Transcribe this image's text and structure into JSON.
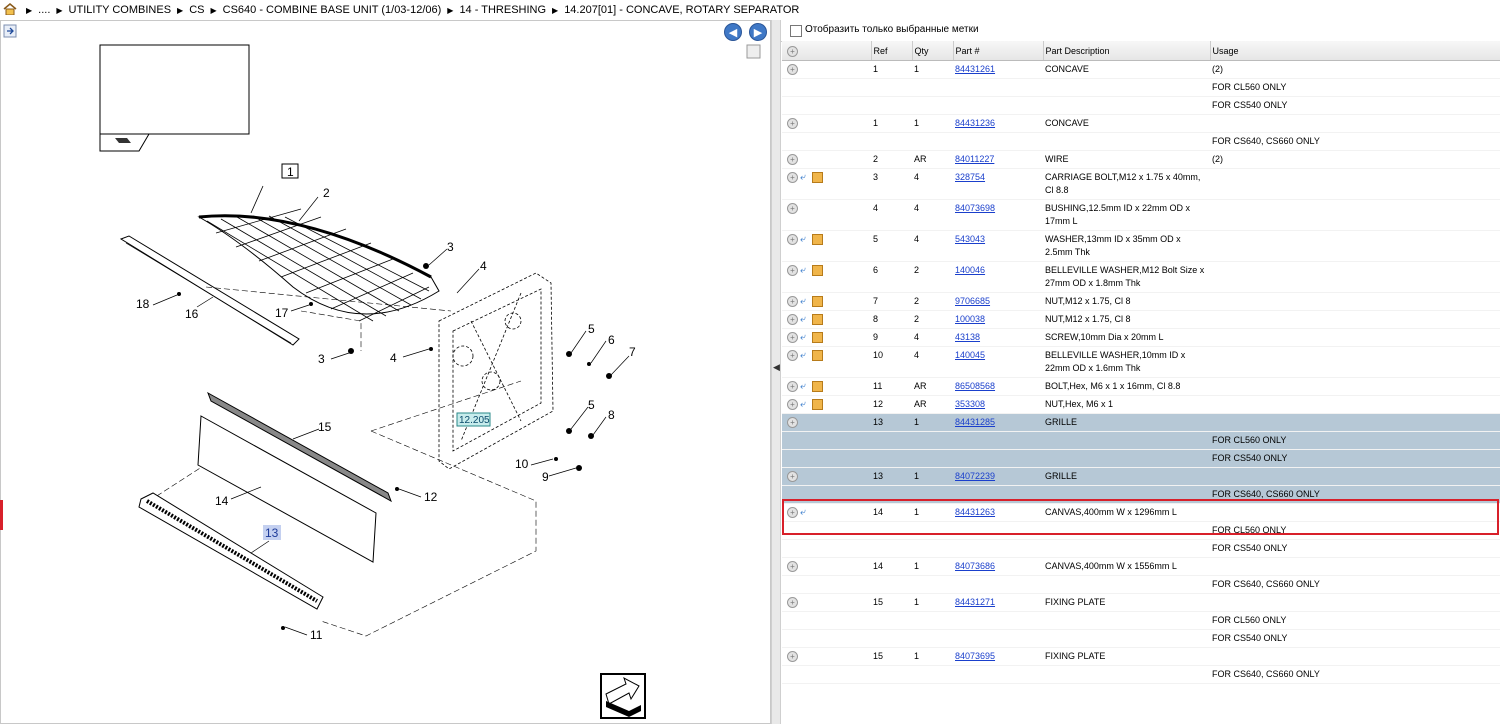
{
  "breadcrumb": {
    "items": [
      "....",
      "UTILITY COMBINES",
      "CS",
      "CS640 - COMBINE BASE UNIT (1/03-12/06)",
      "14 - THRESHING",
      "14.207[01] - CONCAVE, ROTARY SEPARATOR"
    ]
  },
  "filter": {
    "label": "Отобразить только выбранные метки"
  },
  "table": {
    "headers": {
      "ref": "Ref",
      "qty": "Qty",
      "part": "Part #",
      "desc": "Part Description",
      "usage": "Usage"
    },
    "rows": [
      {
        "ref": "1",
        "qty": "1",
        "part": "84431261",
        "desc": "CONCAVE",
        "usage": "(2)",
        "icons": ""
      },
      {
        "ref": "",
        "qty": "",
        "part": "",
        "desc": "",
        "usage": "FOR CL560 ONLY",
        "icons": "none"
      },
      {
        "ref": "",
        "qty": "",
        "part": "",
        "desc": "",
        "usage": "FOR CS540 ONLY",
        "icons": "none"
      },
      {
        "ref": "1",
        "qty": "1",
        "part": "84431236",
        "desc": "CONCAVE",
        "usage": "",
        "icons": ""
      },
      {
        "ref": "",
        "qty": "",
        "part": "",
        "desc": "",
        "usage": "FOR CS640, CS660 ONLY",
        "icons": "none"
      },
      {
        "ref": "2",
        "qty": "AR",
        "part": "84011227",
        "desc": "WIRE",
        "usage": "(2)",
        "icons": ""
      },
      {
        "ref": "3",
        "qty": "4",
        "part": "328754",
        "desc": "CARRIAGE BOLT,M12 x 1.75 x 40mm, Cl 8.8",
        "usage": "",
        "icons": "both"
      },
      {
        "ref": "4",
        "qty": "4",
        "part": "84073698",
        "desc": "BUSHING,12.5mm ID x 22mm OD x 17mm L",
        "usage": "",
        "icons": ""
      },
      {
        "ref": "5",
        "qty": "4",
        "part": "543043",
        "desc": "WASHER,13mm ID x 35mm OD x 2.5mm Thk",
        "usage": "",
        "icons": "both"
      },
      {
        "ref": "6",
        "qty": "2",
        "part": "140046",
        "desc": "BELLEVILLE WASHER,M12 Bolt Size x 27mm OD x 1.8mm Thk",
        "usage": "",
        "icons": "both"
      },
      {
        "ref": "7",
        "qty": "2",
        "part": "9706685",
        "desc": "NUT,M12 x 1.75, Cl 8",
        "usage": "",
        "icons": "both"
      },
      {
        "ref": "8",
        "qty": "2",
        "part": "100038",
        "desc": "NUT,M12 x 1.75, Cl 8",
        "usage": "",
        "icons": "both"
      },
      {
        "ref": "9",
        "qty": "4",
        "part": "43138",
        "desc": "SCREW,10mm Dia x 20mm L",
        "usage": "",
        "icons": "both"
      },
      {
        "ref": "10",
        "qty": "4",
        "part": "140045",
        "desc": "BELLEVILLE WASHER,10mm ID x 22mm OD x 1.6mm Thk",
        "usage": "",
        "icons": "both"
      },
      {
        "ref": "11",
        "qty": "AR",
        "part": "86508568",
        "desc": "BOLT,Hex, M6 x 1 x 16mm, Cl 8.8",
        "usage": "",
        "icons": "both"
      },
      {
        "ref": "12",
        "qty": "AR",
        "part": "353308",
        "desc": "NUT,Hex, M6 x 1",
        "usage": "",
        "icons": "both"
      },
      {
        "ref": "13",
        "qty": "1",
        "part": "84431285",
        "desc": "GRILLE",
        "usage": "",
        "icons": "",
        "style": "hl"
      },
      {
        "ref": "",
        "qty": "",
        "part": "",
        "desc": "",
        "usage": "FOR CL560 ONLY",
        "icons": "none",
        "style": "hl"
      },
      {
        "ref": "",
        "qty": "",
        "part": "",
        "desc": "",
        "usage": "FOR CS540 ONLY",
        "icons": "none",
        "style": "hl"
      },
      {
        "ref": "13",
        "qty": "1",
        "part": "84072239",
        "desc": "GRILLE",
        "usage": "",
        "icons": "",
        "style": "sel"
      },
      {
        "ref": "",
        "qty": "",
        "part": "",
        "desc": "",
        "usage": "FOR CS640, CS660 ONLY",
        "icons": "none",
        "style": "sel"
      },
      {
        "ref": "14",
        "qty": "1",
        "part": "84431263",
        "desc": "CANVAS,400mm W x 1296mm L",
        "usage": "",
        "icons": "undo"
      },
      {
        "ref": "",
        "qty": "",
        "part": "",
        "desc": "",
        "usage": "FOR CL560 ONLY",
        "icons": "none"
      },
      {
        "ref": "",
        "qty": "",
        "part": "",
        "desc": "",
        "usage": "FOR CS540 ONLY",
        "icons": "none"
      },
      {
        "ref": "14",
        "qty": "1",
        "part": "84073686",
        "desc": "CANVAS,400mm W x 1556mm L",
        "usage": "",
        "icons": ""
      },
      {
        "ref": "",
        "qty": "",
        "part": "",
        "desc": "",
        "usage": "FOR CS640, CS660 ONLY",
        "icons": "none"
      },
      {
        "ref": "15",
        "qty": "1",
        "part": "84431271",
        "desc": "FIXING PLATE",
        "usage": "",
        "icons": ""
      },
      {
        "ref": "",
        "qty": "",
        "part": "",
        "desc": "",
        "usage": "FOR CL560 ONLY",
        "icons": "none"
      },
      {
        "ref": "",
        "qty": "",
        "part": "",
        "desc": "",
        "usage": "FOR CS540 ONLY",
        "icons": "none"
      },
      {
        "ref": "15",
        "qty": "1",
        "part": "84073695",
        "desc": "FIXING PLATE",
        "usage": "",
        "icons": ""
      },
      {
        "ref": "",
        "qty": "",
        "part": "",
        "desc": "",
        "usage": "FOR CS640, CS660 ONLY",
        "icons": "none"
      }
    ]
  },
  "diagram": {
    "callouts": [
      "1",
      "2",
      "3",
      "4",
      "3",
      "4",
      "5",
      "6",
      "7",
      "5",
      "8",
      "10",
      "9",
      "18",
      "16",
      "17",
      "15",
      "14",
      "12",
      "13",
      "11"
    ],
    "reference_tag": "12.205"
  },
  "colors": {
    "link": "#1a3fcc",
    "selection": "#b6c8d6",
    "highlight_border": "#d8202a"
  }
}
